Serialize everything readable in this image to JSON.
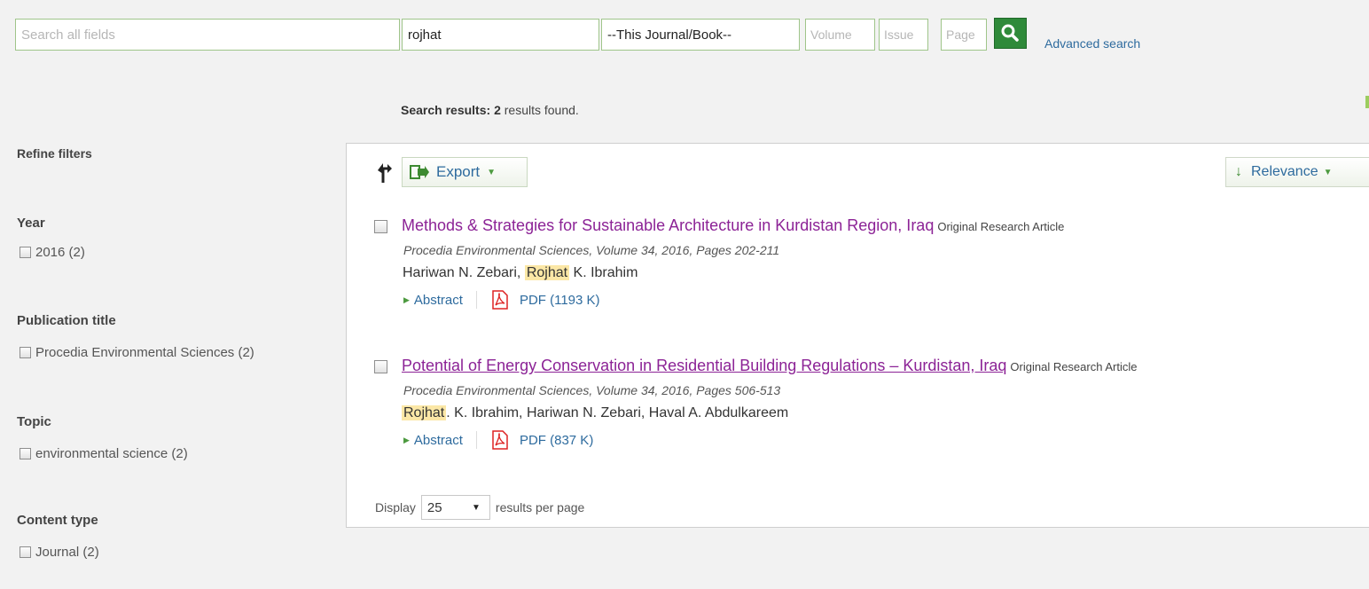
{
  "search": {
    "all_fields_placeholder": "Search all fields",
    "author_value": "rojhat",
    "journal_value": "--This Journal/Book--",
    "volume_placeholder": "Volume",
    "issue_placeholder": "Issue",
    "page_placeholder": "Page",
    "advanced_label": "Advanced search"
  },
  "summary": {
    "label": "Search results:",
    "count": "2",
    "suffix": "results found."
  },
  "sidebar": {
    "title": "Refine filters",
    "facets": [
      {
        "heading": "Year",
        "items": [
          {
            "label": "2016",
            "count": "(2)"
          }
        ]
      },
      {
        "heading": "Publication title",
        "items": [
          {
            "label": "Procedia Environmental Sciences",
            "count": "(2)"
          }
        ]
      },
      {
        "heading": "Topic",
        "items": [
          {
            "label": "environmental science",
            "count": "(2)"
          }
        ]
      },
      {
        "heading": "Content type",
        "items": [
          {
            "label": "Journal",
            "count": "(2)"
          }
        ]
      }
    ]
  },
  "toolbar": {
    "export_label": "Export",
    "sort_label": "Relevance"
  },
  "results": [
    {
      "title": "Methods & Strategies for Sustainable Architecture in Kurdistan Region, Iraq",
      "type": "Original Research Article",
      "source": "Procedia Environmental Sciences, Volume 34, 2016, Pages 202-211",
      "authors_before": "Hariwan N. Zebari, ",
      "authors_highlight": "Rojhat",
      "authors_after": " K. Ibrahim",
      "abstract_label": "Abstract",
      "pdf_label": "PDF (1193 K)"
    },
    {
      "title": "Potential of Energy Conservation in Residential Building Regulations – Kurdistan, Iraq",
      "type": "Original Research Article",
      "source": "Procedia Environmental Sciences, Volume 34, 2016, Pages 506-513",
      "authors_before": "",
      "authors_highlight": "Rojhat",
      "authors_after": ". K. Ibrahim, Hariwan N. Zebari, Haval A. Abdulkareem",
      "abstract_label": "Abstract",
      "pdf_label": "PDF (837 K)"
    }
  ],
  "pagination": {
    "display_label": "Display",
    "per_page_value": "25",
    "suffix": "results per page"
  },
  "colors": {
    "link": "#2e6b9e",
    "title": "#8c2396",
    "brand_green": "#2f8a3a",
    "highlight": "#fbe7a6"
  }
}
